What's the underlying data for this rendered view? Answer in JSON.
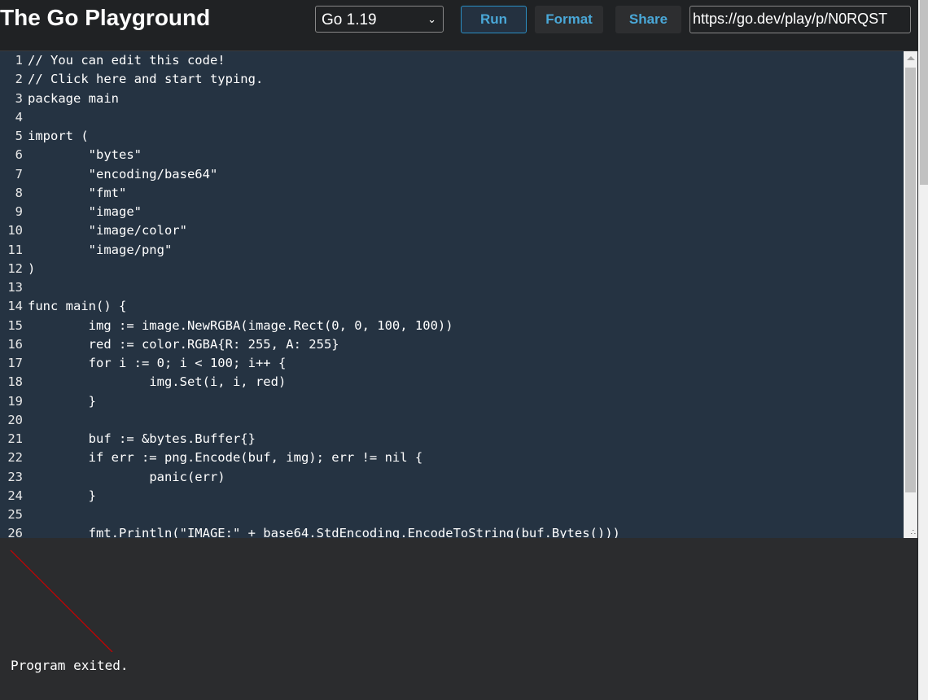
{
  "header": {
    "title": "The Go Playground",
    "version_select": "Go 1.19",
    "run_label": "Run",
    "format_label": "Format",
    "share_label": "Share",
    "share_url": "https://go.dev/play/p/N0RQST"
  },
  "editor": {
    "lines": [
      "// You can edit this code!",
      "// Click here and start typing.",
      "package main",
      "",
      "import (",
      "\t\"bytes\"",
      "\t\"encoding/base64\"",
      "\t\"fmt\"",
      "\t\"image\"",
      "\t\"image/color\"",
      "\t\"image/png\"",
      ")",
      "",
      "func main() {",
      "\timg := image.NewRGBA(image.Rect(0, 0, 100, 100))",
      "\tred := color.RGBA{R: 255, A: 255}",
      "\tfor i := 0; i < 100; i++ {",
      "\t\timg.Set(i, i, red)",
      "\t}",
      "",
      "\tbuf := &bytes.Buffer{}",
      "\tif err := png.Encode(buf, img); err != nil {",
      "\t\tpanic(err)",
      "\t}",
      "",
      "\tfmt.Println(\"IMAGE:\" + base64.StdEncoding.EncodeToString(buf.Bytes()))"
    ]
  },
  "output": {
    "status": "Program exited.",
    "image_line_color": "#cc0000"
  }
}
